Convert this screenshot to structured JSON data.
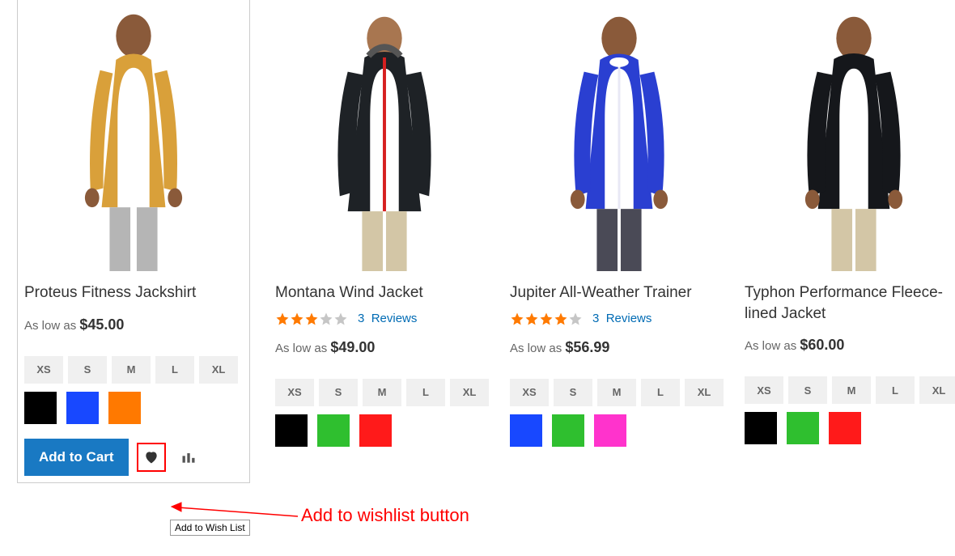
{
  "labels": {
    "as_low_as": "As low as",
    "reviews": "Reviews",
    "add_to_cart": "Add to Cart",
    "tooltip_wishlist": "Add to Wish List"
  },
  "annotation": {
    "text": "Add to wishlist button"
  },
  "products": [
    {
      "name": "Proteus Fitness Jackshirt",
      "price": "$45.00",
      "rating_filled": 0,
      "rating_total": 0,
      "reviews_count": null,
      "sizes": [
        "XS",
        "S",
        "M",
        "L",
        "XL"
      ],
      "colors": [
        "#000000",
        "#1848ff",
        "#ff7900"
      ],
      "garment_color": "#d9a03a",
      "hovered": true
    },
    {
      "name": "Montana Wind Jacket",
      "price": "$49.00",
      "rating_filled": 3,
      "rating_total": 5,
      "reviews_count": "3",
      "sizes": [
        "XS",
        "S",
        "M",
        "L",
        "XL"
      ],
      "colors": [
        "#000000",
        "#2fbf2f",
        "#ff1a1a"
      ],
      "garment_color": "#1e2226",
      "hovered": false
    },
    {
      "name": "Jupiter All-Weather Trainer",
      "price": "$56.99",
      "rating_filled": 4,
      "rating_total": 5,
      "reviews_count": "3",
      "sizes": [
        "XS",
        "S",
        "M",
        "L",
        "XL"
      ],
      "colors": [
        "#1848ff",
        "#2fbf2f",
        "#ff33cc"
      ],
      "garment_color": "#2a3fd1",
      "hovered": false
    },
    {
      "name": "Typhon Performance Fleece-lined Jacket",
      "price": "$60.00",
      "rating_filled": 0,
      "rating_total": 0,
      "reviews_count": null,
      "sizes": [
        "XS",
        "S",
        "M",
        "L",
        "XL"
      ],
      "colors": [
        "#000000",
        "#2fbf2f",
        "#ff1a1a"
      ],
      "garment_color": "#15171b",
      "hovered": false
    }
  ]
}
